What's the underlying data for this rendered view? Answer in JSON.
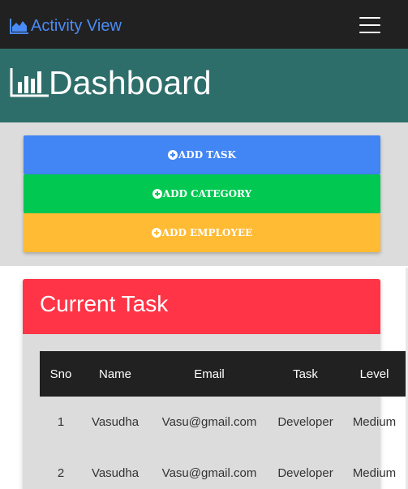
{
  "navbar": {
    "brand_label": "Activity View",
    "brand_icon": "area-chart-icon",
    "menu_icon": "hamburger-menu-icon",
    "background": "#212121",
    "brand_color": "#4a8bf5"
  },
  "header": {
    "title": "Dashboard",
    "icon": "bar-chart-icon",
    "background": "#2e6e6a"
  },
  "actions": [
    {
      "label": "ADD TASK",
      "icon": "plus-circle-icon",
      "color": "#4285f4"
    },
    {
      "label": "ADD CATEGORY",
      "icon": "plus-circle-icon",
      "color": "#00c851"
    },
    {
      "label": "ADD EMPLOYEE",
      "icon": "plus-circle-icon",
      "color": "#ffbb33"
    }
  ],
  "current_task": {
    "title": "Current Task",
    "header_color": "#ff3547",
    "columns": [
      "Sno",
      "Name",
      "Email",
      "Task",
      "Level"
    ],
    "rows": [
      [
        "1",
        "Vasudha",
        "Vasu@gmail.com",
        "Developer",
        "Medium"
      ],
      [
        "2",
        "Vasudha",
        "Vasu@gmail.com",
        "Developer",
        "Medium"
      ]
    ]
  }
}
